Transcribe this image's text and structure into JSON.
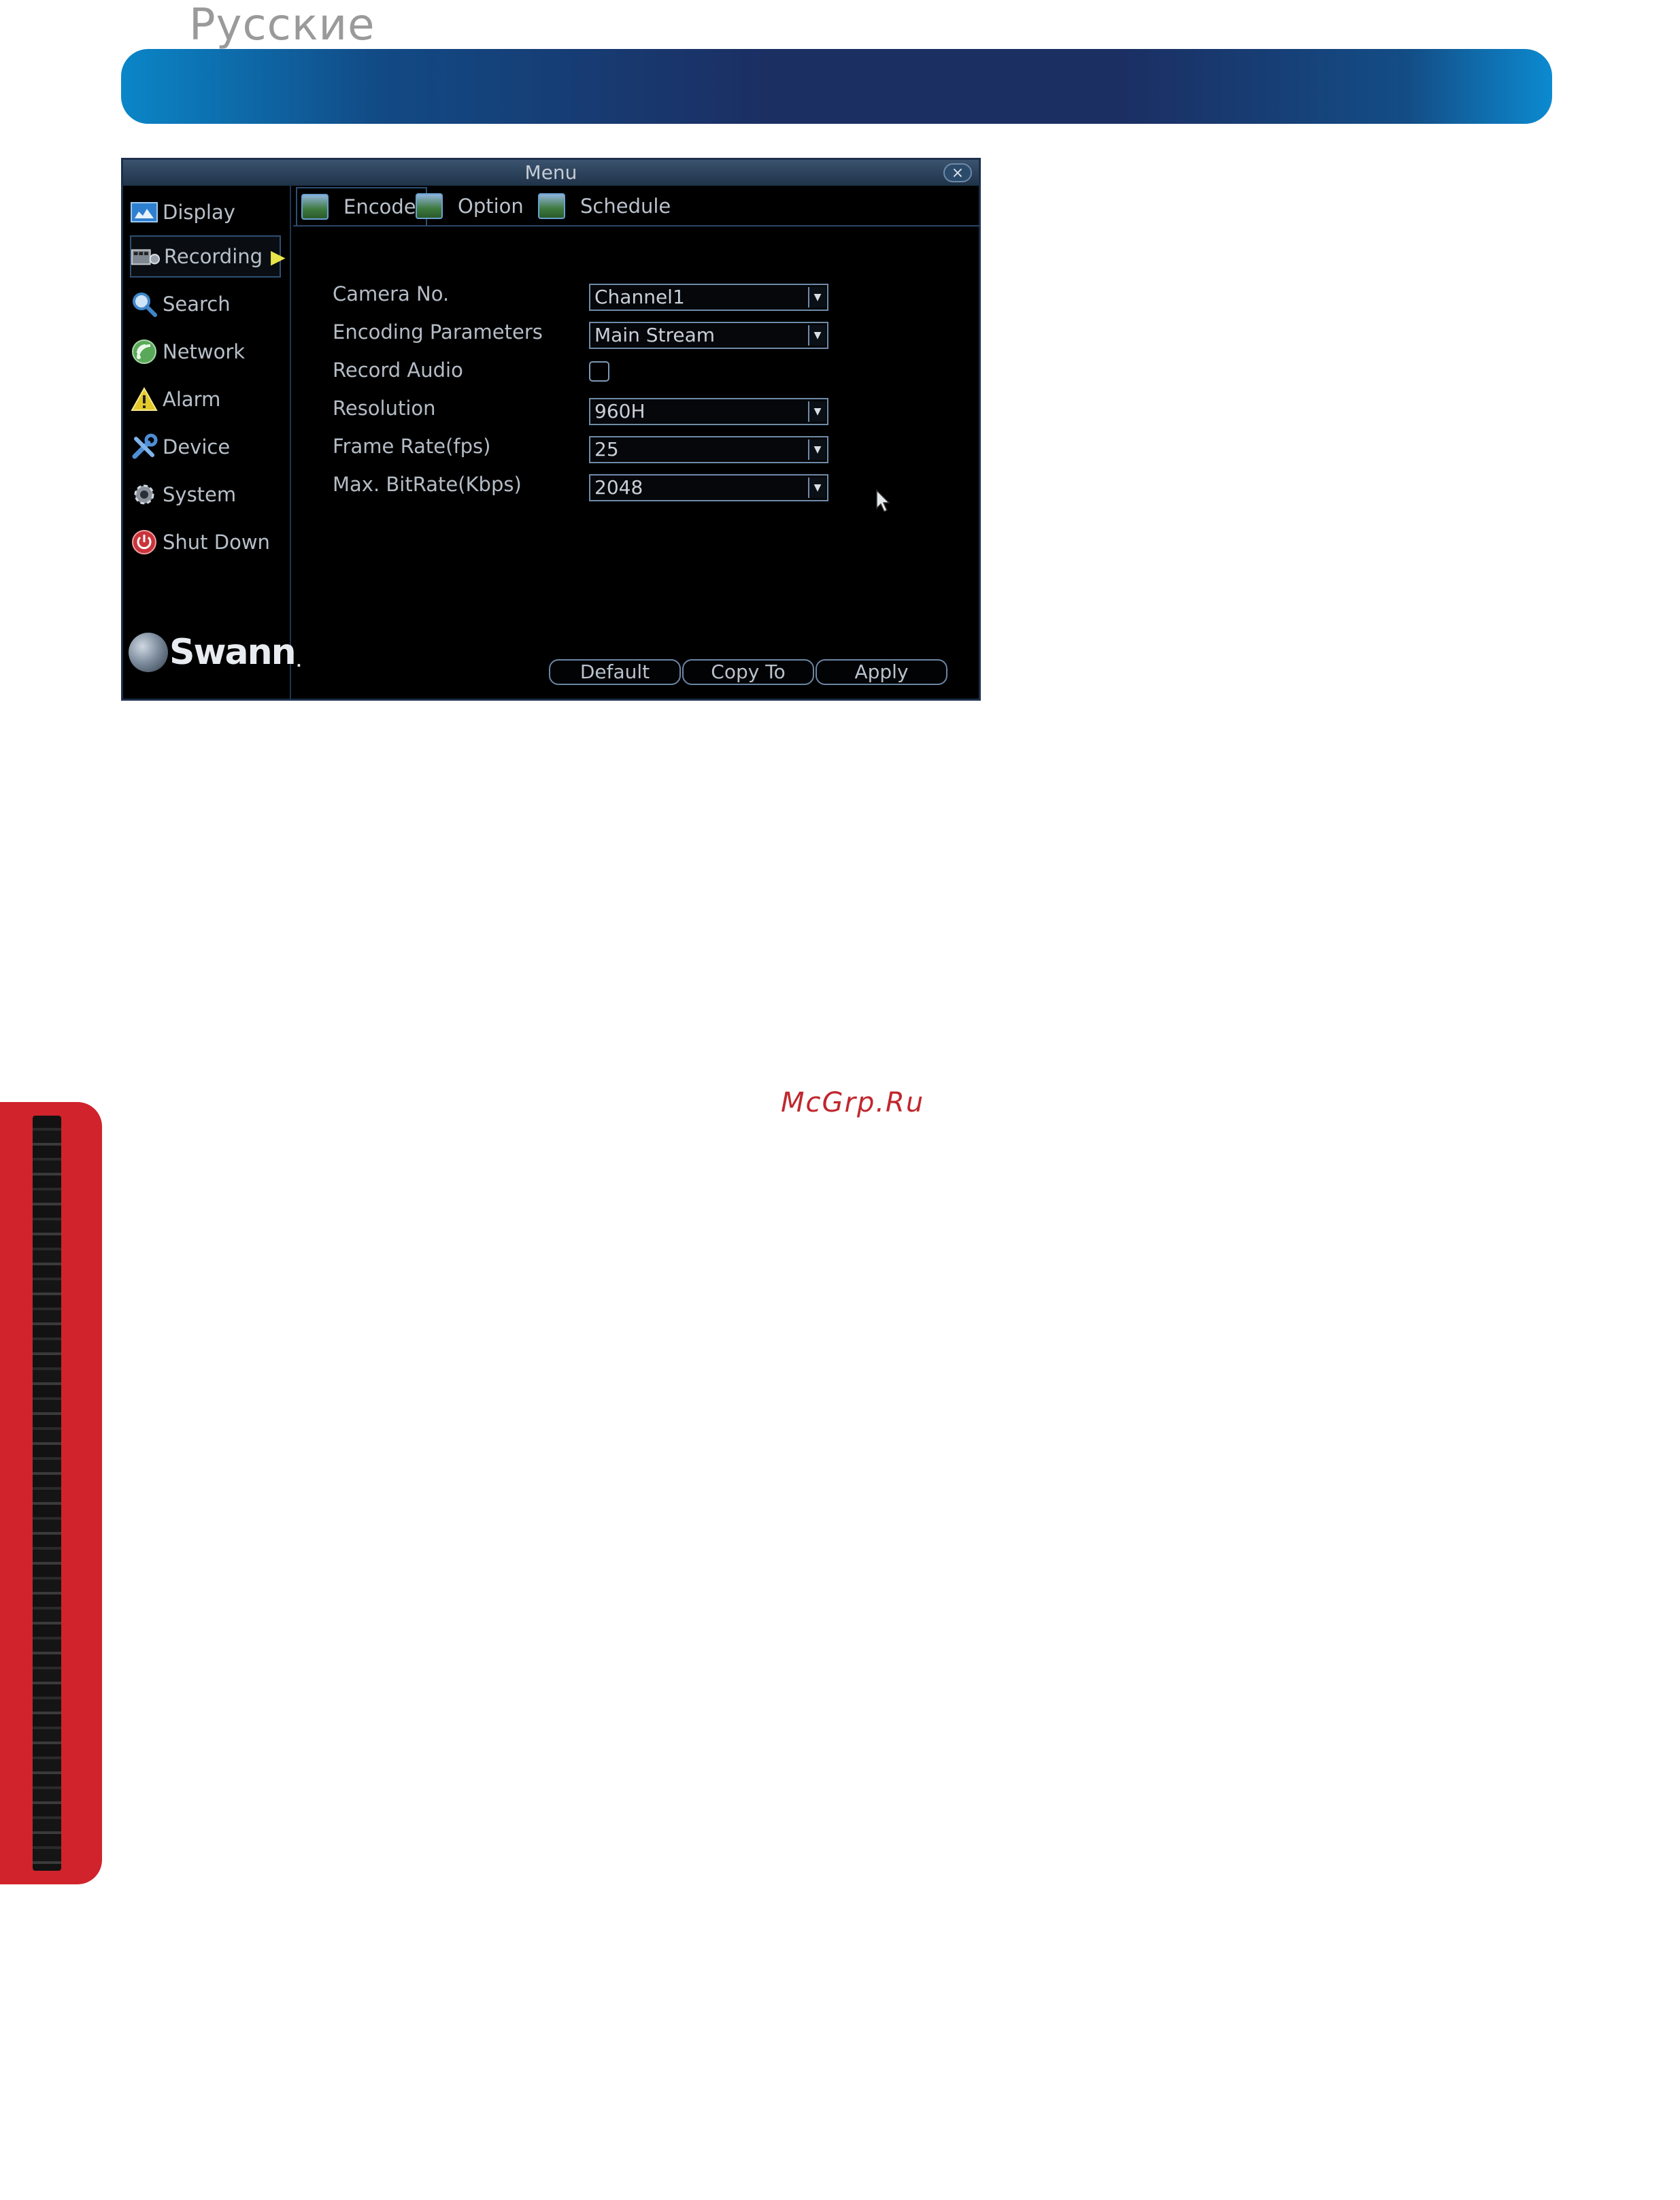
{
  "page": {
    "language_heading": "Русские",
    "watermark": "McGrp.Ru"
  },
  "window": {
    "title": "Menu",
    "close_label": "×"
  },
  "sidebar": {
    "items": [
      {
        "label": "Display",
        "icon": "display-icon"
      },
      {
        "label": "Recording",
        "icon": "recording-icon",
        "active": true
      },
      {
        "label": "Search",
        "icon": "search-icon"
      },
      {
        "label": "Network",
        "icon": "network-icon"
      },
      {
        "label": "Alarm",
        "icon": "alarm-icon"
      },
      {
        "label": "Device",
        "icon": "device-icon"
      },
      {
        "label": "System",
        "icon": "system-icon"
      },
      {
        "label": "Shut Down",
        "icon": "power-icon"
      }
    ],
    "logo_text": "Swann",
    "logo_dot": "."
  },
  "tabs": [
    {
      "label": "Encode",
      "active": true
    },
    {
      "label": "Option"
    },
    {
      "label": "Schedule"
    }
  ],
  "form": {
    "camera_no": {
      "label": "Camera No.",
      "value": "Channel1"
    },
    "encoding_parameters": {
      "label": "Encoding Parameters",
      "value": "Main Stream"
    },
    "record_audio": {
      "label": "Record Audio",
      "checked": false
    },
    "resolution": {
      "label": "Resolution",
      "value": "960H"
    },
    "frame_rate": {
      "label": "Frame Rate(fps)",
      "value": "25"
    },
    "max_bitrate": {
      "label": "Max. BitRate(Kbps)",
      "value": "2048"
    }
  },
  "buttons": {
    "default_label": "Default",
    "copy_to_label": "Copy To",
    "apply_label": "Apply"
  },
  "colors": {
    "header_accent": "#1b2f63",
    "side_tab": "#d0232b",
    "active_arrow": "#e7e54a"
  }
}
